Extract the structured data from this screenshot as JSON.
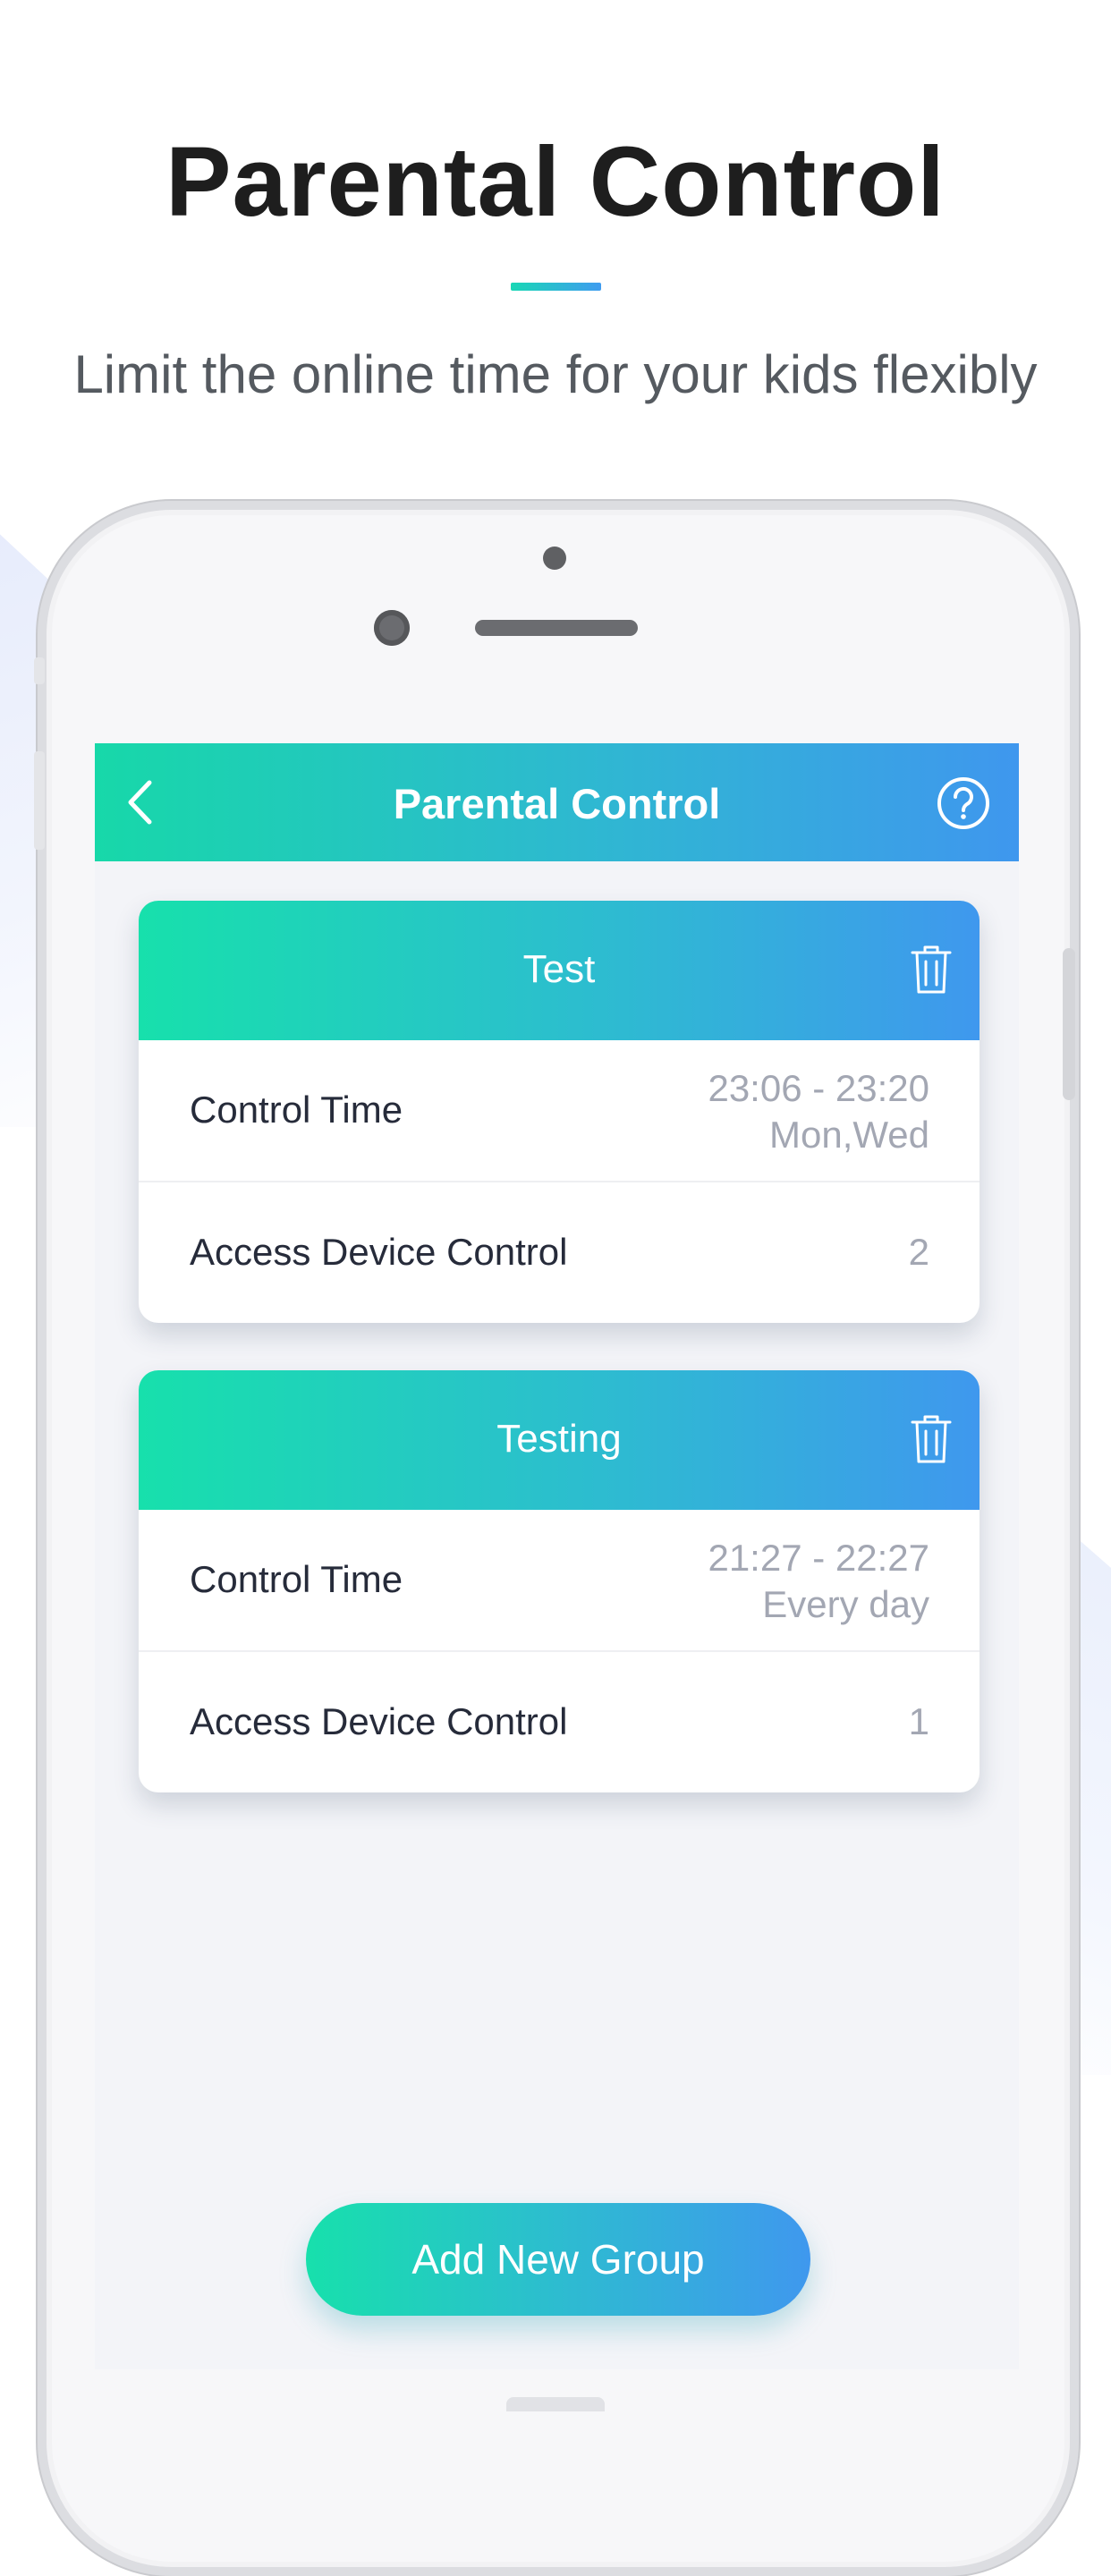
{
  "hero": {
    "title": "Parental Control",
    "subtitle": "Limit the online time for your kids flexibly"
  },
  "app": {
    "nav_title": "Parental Control",
    "icons": {
      "back": "chevron-left-icon",
      "help": "question-circle-icon",
      "delete": "trash-icon"
    },
    "groups": [
      {
        "name": "Test",
        "rows": [
          {
            "label": "Control Time",
            "time": "23:06 - 23:20",
            "days": "Mon,Wed"
          },
          {
            "label": "Access Device Control",
            "value": "2"
          }
        ]
      },
      {
        "name": "Testing",
        "rows": [
          {
            "label": "Control Time",
            "time": "21:27 - 22:27",
            "days": "Every day"
          },
          {
            "label": "Access Device Control",
            "value": "1"
          }
        ]
      }
    ],
    "add_button": "Add New Group"
  },
  "colors": {
    "gradient_start": "#17e0ac",
    "gradient_end": "#3f98ee",
    "text_dark": "#262b3a",
    "text_muted": "#a3a7b3"
  }
}
